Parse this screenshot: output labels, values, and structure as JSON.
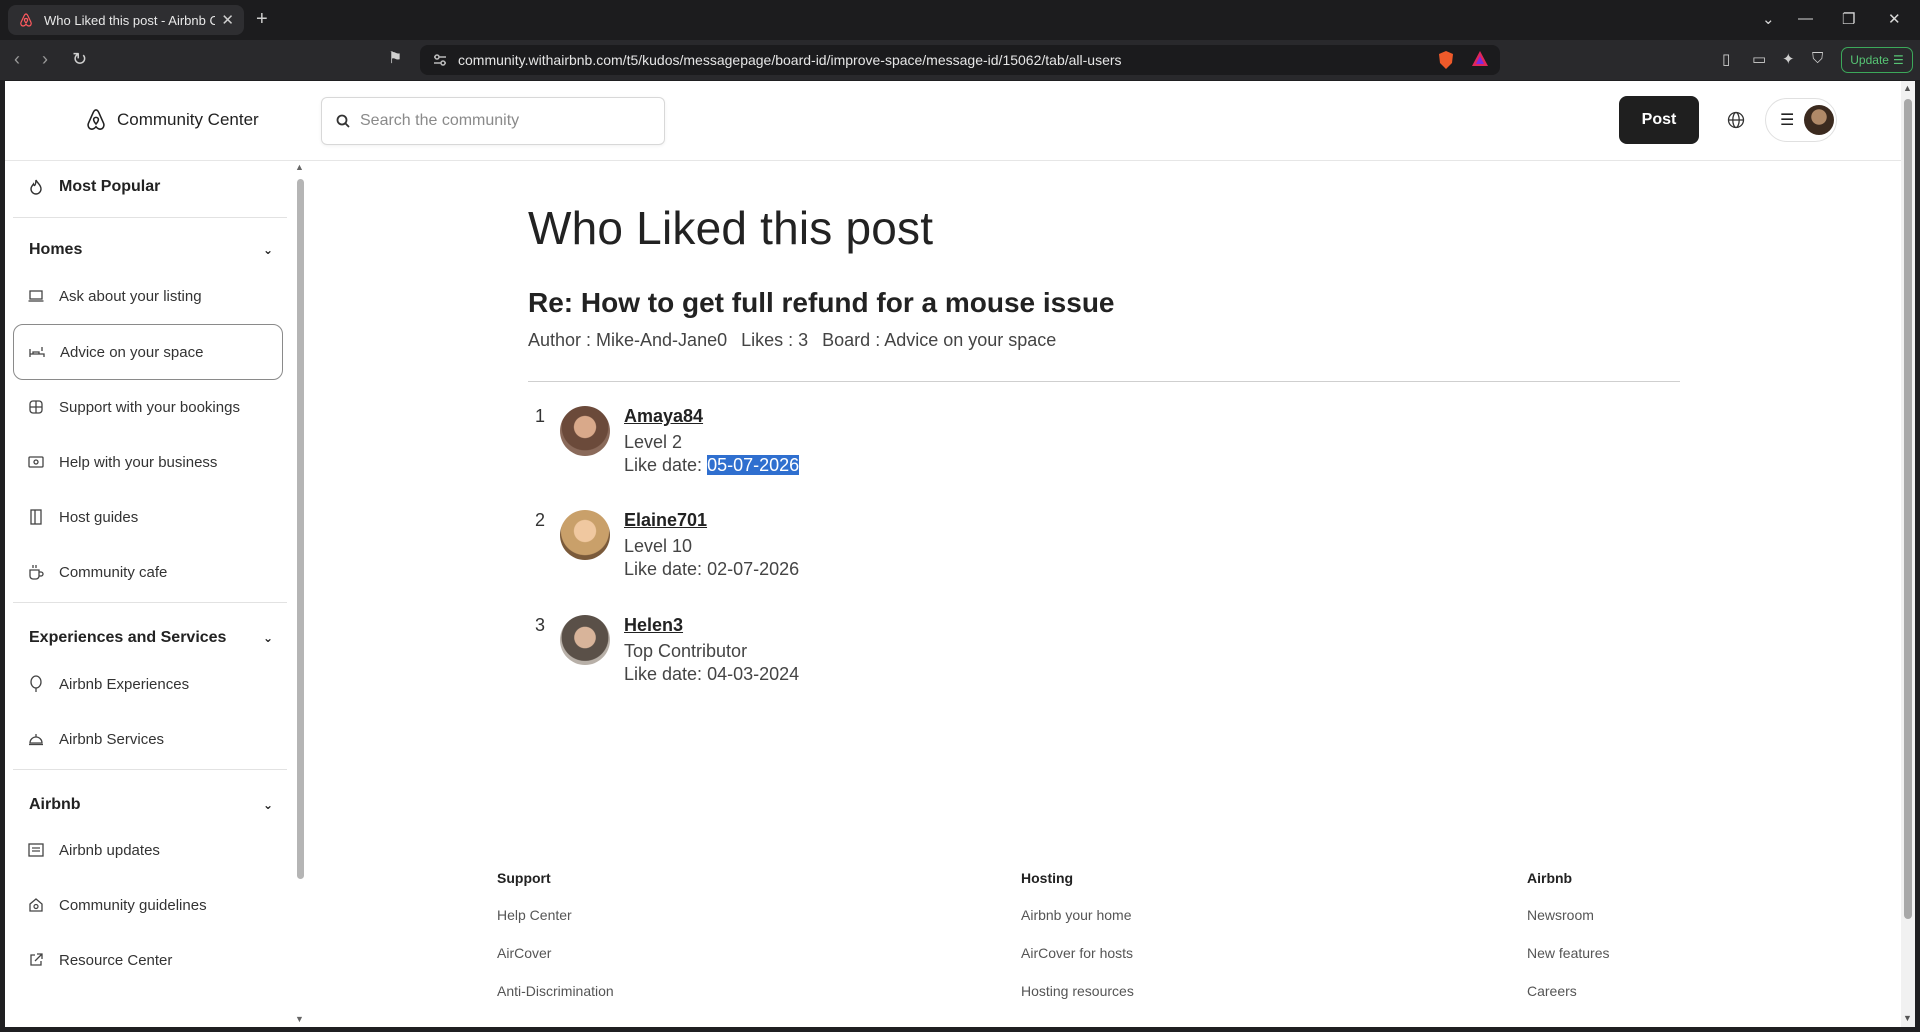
{
  "browser": {
    "tab_title": "Who Liked this post - Airbnb Co",
    "url": "community.withairbnb.com/t5/kudos/messagepage/board-id/improve-space/message-id/15062/tab/all-users",
    "update_label": "Update"
  },
  "header": {
    "logo_text": "Community Center",
    "search_placeholder": "Search the community",
    "post_label": "Post"
  },
  "sidebar": {
    "most_popular": "Most Popular",
    "homes_title": "Homes",
    "homes_items": [
      "Ask about your listing",
      "Advice on your space",
      "Support with your bookings",
      "Help with your business",
      "Host guides",
      "Community cafe"
    ],
    "exp_title": "Experiences and Services",
    "exp_items": [
      "Airbnb Experiences",
      "Airbnb Services"
    ],
    "airbnb_title": "Airbnb",
    "airbnb_items": [
      "Airbnb updates",
      "Community guidelines",
      "Resource Center"
    ]
  },
  "main": {
    "title": "Who Liked this post",
    "post_title": "Re: How to get full refund for a mouse issue",
    "author": "Author : Mike-And-Jane0",
    "likes": "Likes : 3",
    "board": "Board : Advice on your space",
    "likers": [
      {
        "num": "1",
        "name": "Amaya84",
        "level": "Level 2",
        "date_label": "Like date: ",
        "date": "05-07-2026"
      },
      {
        "num": "2",
        "name": "Elaine701",
        "level": "Level 10",
        "date_label": "Like date: ",
        "date": "02-07-2026"
      },
      {
        "num": "3",
        "name": "Helen3",
        "level": "Top Contributor",
        "date_label": "Like date: ",
        "date": "04-03-2024"
      }
    ]
  },
  "footer": {
    "support": {
      "title": "Support",
      "links": [
        "Help Center",
        "AirCover",
        "Anti-Discrimination"
      ]
    },
    "hosting": {
      "title": "Hosting",
      "links": [
        "Airbnb your home",
        "AirCover for hosts",
        "Hosting resources"
      ]
    },
    "airbnb": {
      "title": "Airbnb",
      "links": [
        "Newsroom",
        "New features",
        "Careers"
      ]
    }
  },
  "colors": {
    "selection": "#2f6fcf",
    "brand": "#222222",
    "update": "#3ca85a"
  }
}
